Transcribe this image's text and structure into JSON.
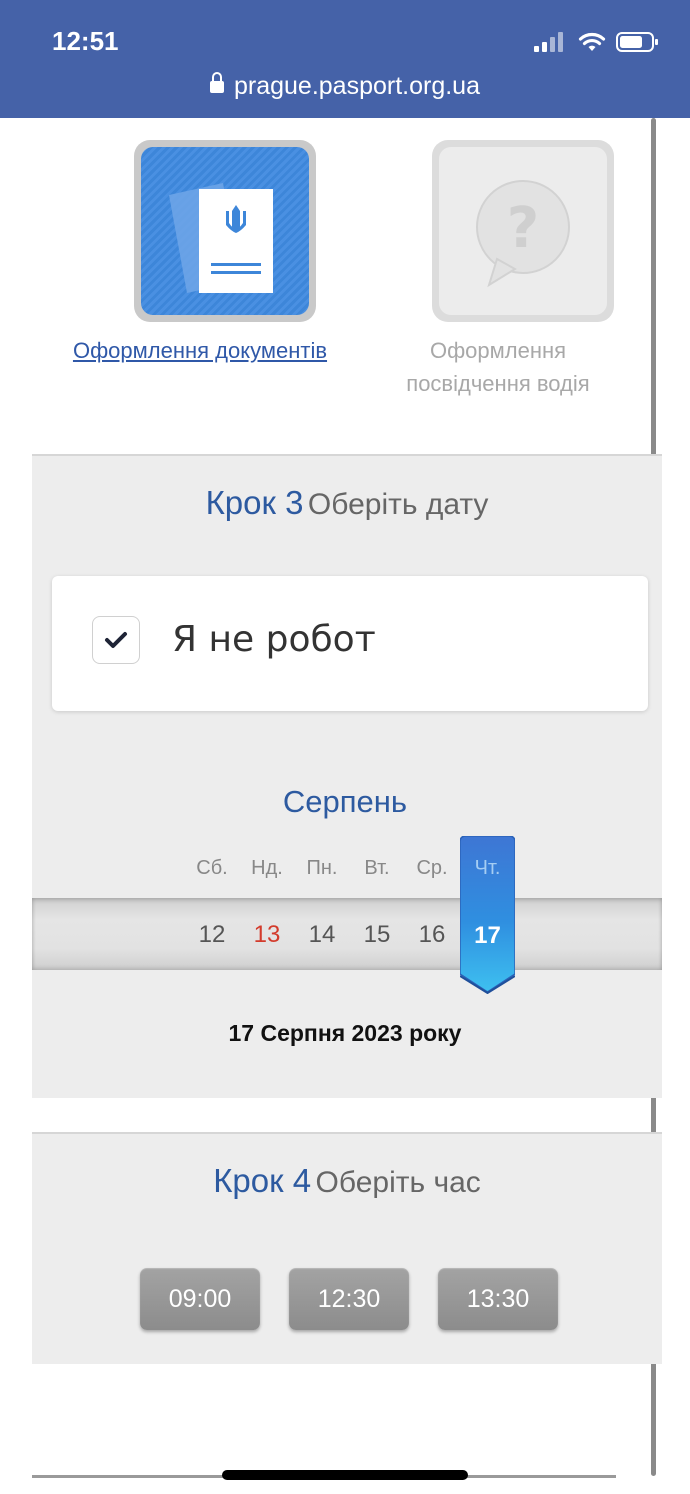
{
  "status_bar": {
    "time": "12:51",
    "url": "prague.pasport.org.ua",
    "background_color": "#4562a8"
  },
  "services": [
    {
      "label": "Оформлення документів",
      "icon": "ukrainian-passport-icon",
      "active": true
    },
    {
      "label": "Оформлення посвідчення водія",
      "icon": "question-bubble-icon",
      "active": false
    }
  ],
  "step3": {
    "number": "Крок 3",
    "title": "Оберіть дату",
    "captcha_label": "Я не робот",
    "captcha_checked": true,
    "month": "Серпень",
    "days": [
      {
        "dow": "Сб.",
        "day": "12"
      },
      {
        "dow": "Нд.",
        "day": "13"
      },
      {
        "dow": "Пн.",
        "day": "14"
      },
      {
        "dow": "Вт.",
        "day": "15"
      },
      {
        "dow": "Ср.",
        "day": "16"
      },
      {
        "dow": "Чт.",
        "day": "17"
      }
    ],
    "selected_day": "17",
    "selected_date_text": "17 Серпня 2023 року",
    "sunday_color": "#d33b2c",
    "accent_color": "#2d5aa0"
  },
  "step4": {
    "number": "Крок 4",
    "title": "Оберіть час",
    "times": [
      "09:00",
      "12:30",
      "13:30"
    ]
  }
}
